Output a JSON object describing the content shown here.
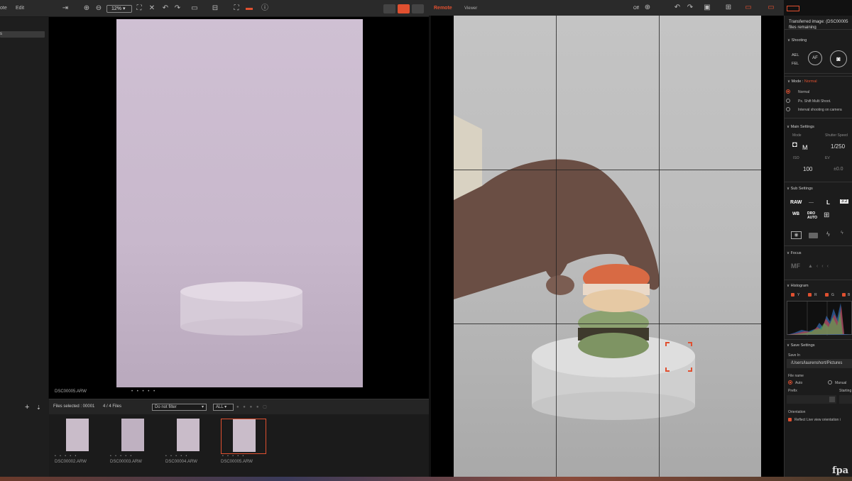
{
  "left_toolbar": {
    "menu1": "ote",
    "menu2": "Edit",
    "zoom": "12%"
  },
  "left_sidebar": {
    "selected": "s"
  },
  "viewer": {
    "filename": "DSC00005.ARW",
    "rating_dots": "• • • • •"
  },
  "filmstrip": {
    "files_selected": "Files selected : 00001",
    "count": "4 / 4 Files",
    "filter": "Do not filter",
    "all": "ALL",
    "thumbs": [
      {
        "name": "DSC00002.ARW",
        "stars": "• • • • •"
      },
      {
        "name": "DSC00003.ARW",
        "stars": "• • • • •"
      },
      {
        "name": "DSC00004.ARW",
        "stars": "• • • • •"
      },
      {
        "name": "DSC00005.ARW",
        "stars": "• • • • •"
      }
    ]
  },
  "right_toolbar": {
    "remote": "Remote",
    "viewer": "Viewer",
    "off": "Off"
  },
  "panel": {
    "transfer": "Transferred image: (DSC00005",
    "remaining": "files remaining",
    "shooting": "Shooting",
    "ael": "AEL",
    "fel": "FEL",
    "af": "AF",
    "mode_label": "Mode :",
    "mode_value": "Normal",
    "modes": [
      "Normal",
      "Px. Shift Multi Shoot.",
      "Interval shooting on camera"
    ],
    "main_settings": "Main Settings",
    "mode": "Mode",
    "shutter_speed": "Shutter Speed",
    "mode_value_main": "M",
    "shutter": "1/250",
    "iso_label": "ISO",
    "ev_label": "EV",
    "iso": "100",
    "ev": "±0.0",
    "sub_settings": "Sub Settings",
    "raw": "RAW",
    "dash": "—",
    "size": "L",
    "ratio": "3:2",
    "wb": "WB",
    "dro": "DRO AUTO",
    "focus": "Focus",
    "mf": "MF",
    "histogram": "Histogram",
    "hist_channels": [
      "Y",
      "R",
      "G",
      "B"
    ],
    "save_settings": "Save Settings",
    "save_in": "Save In",
    "path": "/Users/laurenshort/Pictures",
    "file_name": "File name",
    "auto": "Auto",
    "manual": "Manual",
    "prefix": "Prefix",
    "starting": "Starting",
    "orientation": "Orientation",
    "reflect": "Reflect Live view orientation i"
  },
  "watermark": "fpa"
}
